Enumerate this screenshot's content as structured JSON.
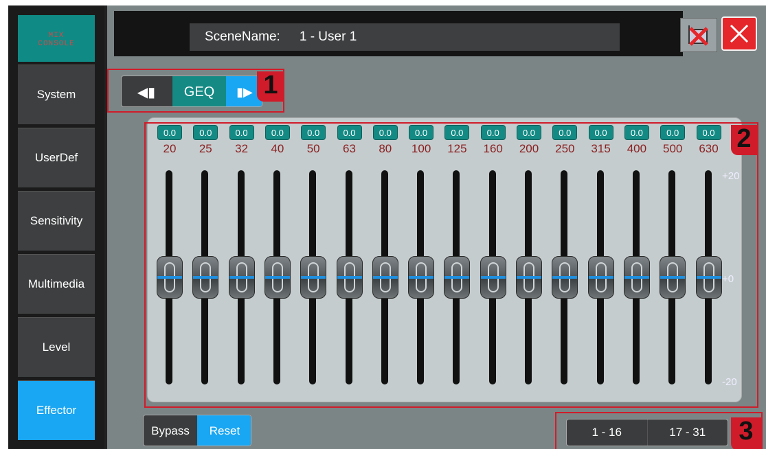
{
  "sidebar": {
    "logo": {
      "line1": "MIX",
      "line2": "CONSOLE"
    },
    "items": [
      {
        "label": "System"
      },
      {
        "label": "UserDef"
      },
      {
        "label": "Sensitivity"
      },
      {
        "label": "Multimedia"
      },
      {
        "label": "Level"
      },
      {
        "label": "Effector",
        "active": true
      }
    ]
  },
  "header": {
    "scene_label": "SceneName:",
    "scene_value": "1 - User 1",
    "save_icon": "save-icon",
    "close_icon": "close-icon"
  },
  "effect_nav": {
    "prev_icon": "prev-arrow-icon",
    "name": "GEQ",
    "next_icon": "next-arrow-icon"
  },
  "markers": [
    "1",
    "2",
    "3"
  ],
  "eq": {
    "bands": [
      {
        "freq": "20",
        "gain": "0.0"
      },
      {
        "freq": "25",
        "gain": "0.0"
      },
      {
        "freq": "32",
        "gain": "0.0"
      },
      {
        "freq": "40",
        "gain": "0.0"
      },
      {
        "freq": "50",
        "gain": "0.0"
      },
      {
        "freq": "63",
        "gain": "0.0"
      },
      {
        "freq": "80",
        "gain": "0.0"
      },
      {
        "freq": "100",
        "gain": "0.0"
      },
      {
        "freq": "125",
        "gain": "0.0"
      },
      {
        "freq": "160",
        "gain": "0.0"
      },
      {
        "freq": "200",
        "gain": "0.0"
      },
      {
        "freq": "250",
        "gain": "0.0"
      },
      {
        "freq": "315",
        "gain": "0.0"
      },
      {
        "freq": "400",
        "gain": "0.0"
      },
      {
        "freq": "500",
        "gain": "0.0"
      },
      {
        "freq": "630",
        "gain": "0.0"
      }
    ],
    "scale": {
      "top": "+20",
      "mid": "+0",
      "bottom": "-20"
    }
  },
  "controls": {
    "bypass": "Bypass",
    "reset": "Reset"
  },
  "pages": [
    "1 - 16",
    "17 - 31"
  ],
  "colors": {
    "accent": "#19a6f2",
    "teal": "#148a84",
    "marker": "#d01c2a",
    "close": "#e5262a"
  }
}
